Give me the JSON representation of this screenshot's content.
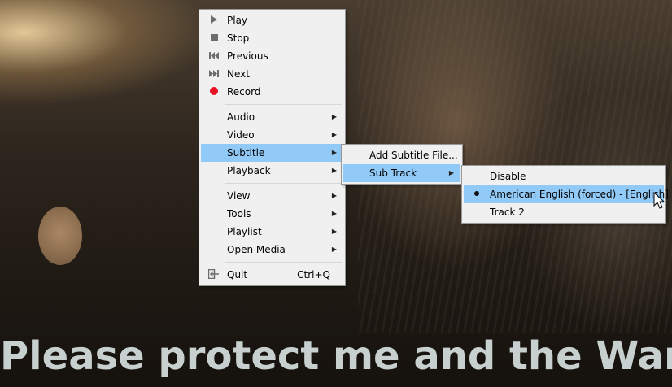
{
  "video": {
    "caption": "Please protect me and the Wand"
  },
  "main_menu": {
    "items": [
      {
        "label": "Play",
        "icon": "play-icon"
      },
      {
        "label": "Stop",
        "icon": "stop-icon"
      },
      {
        "label": "Previous",
        "icon": "previous-icon"
      },
      {
        "label": "Next",
        "icon": "next-icon"
      },
      {
        "label": "Record",
        "icon": "record-icon"
      },
      {
        "label": "Audio"
      },
      {
        "label": "Video"
      },
      {
        "label": "Subtitle",
        "highlighted": true
      },
      {
        "label": "Playback"
      },
      {
        "label": "View"
      },
      {
        "label": "Tools"
      },
      {
        "label": "Playlist"
      },
      {
        "label": "Open Media"
      },
      {
        "label": "Quit",
        "shortcut": "Ctrl+Q",
        "icon": "quit-icon"
      }
    ]
  },
  "subtitle_menu": {
    "items": [
      {
        "label": "Add Subtitle File..."
      },
      {
        "label": "Sub Track",
        "highlighted": true
      }
    ]
  },
  "subtrack_menu": {
    "items": [
      {
        "label": "Disable"
      },
      {
        "label": "American English (forced) - [English]",
        "selected": true,
        "highlighted": true
      },
      {
        "label": "Track 2"
      }
    ]
  },
  "colors": {
    "menu_bg": "#f0f0f0",
    "highlight": "#91c9f7",
    "record": "#e81123",
    "caption": "#c8d0cf"
  }
}
